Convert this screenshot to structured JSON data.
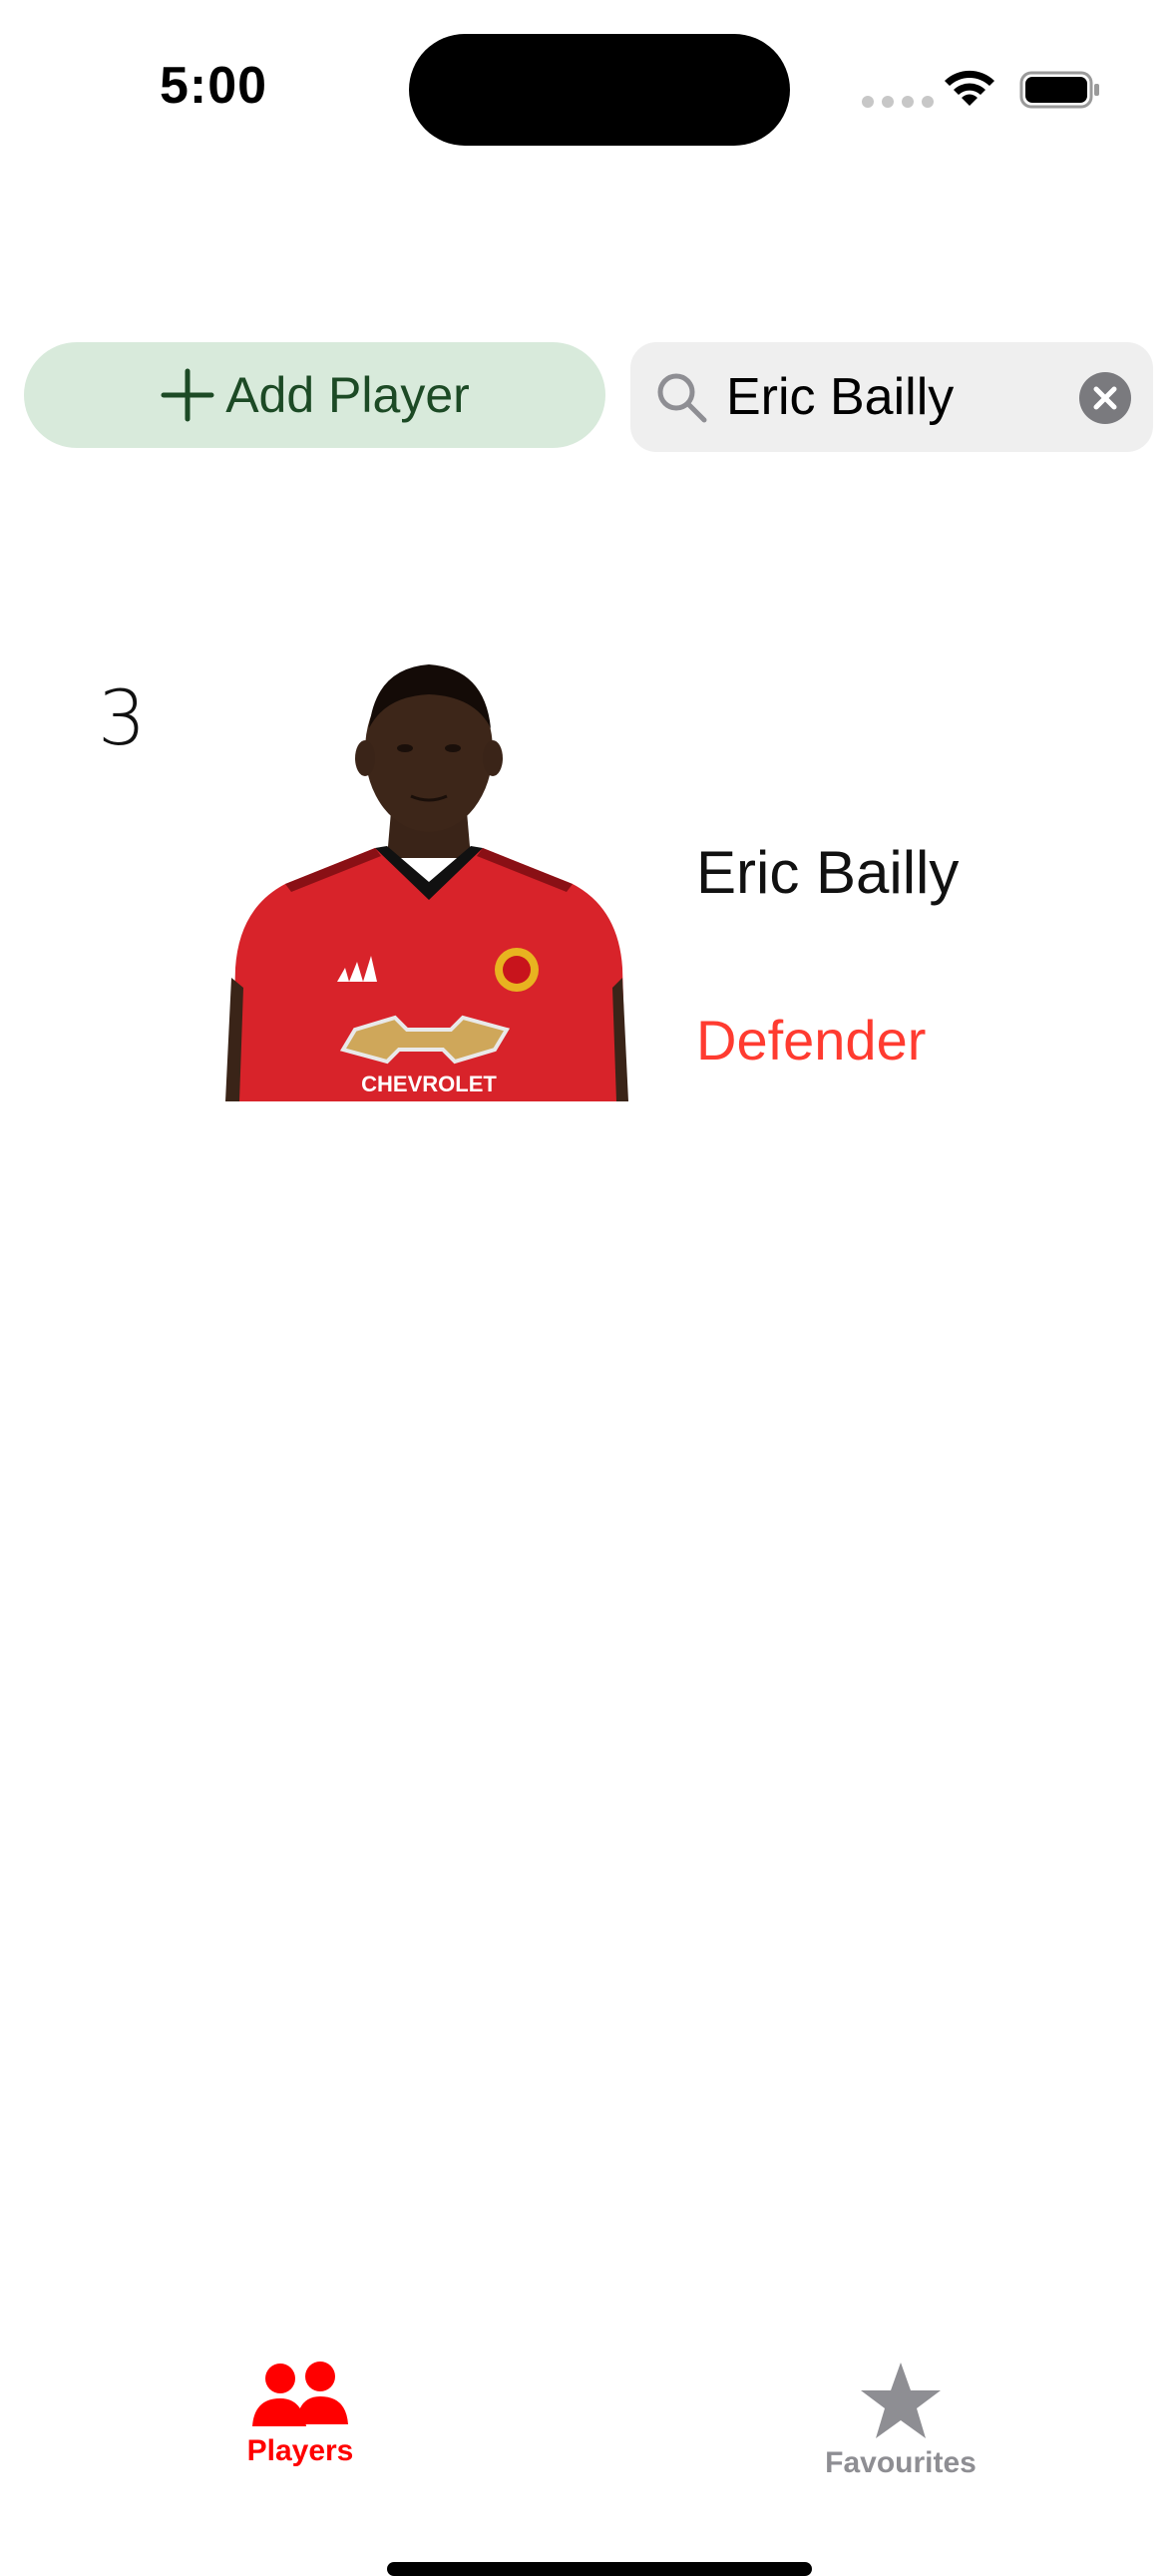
{
  "status_bar": {
    "time": "5:00"
  },
  "toolbar": {
    "add_player_label": "Add Player",
    "add_icon": "plus-icon"
  },
  "search": {
    "value": "Eric Bailly",
    "search_icon": "magnifying-glass-icon",
    "clear_icon": "xmark-circle-icon"
  },
  "players": [
    {
      "number": "3",
      "name": "Eric Bailly",
      "position": "Defender",
      "photo_icon": "player-photo",
      "shirt_sponsor": "CHEVROLET"
    }
  ],
  "tabs": [
    {
      "label": "Players",
      "icon": "person-2-fill-icon",
      "selected": true
    },
    {
      "label": "Favourites",
      "icon": "star-fill-icon",
      "selected": false
    }
  ],
  "colors": {
    "accent": "#ff0000",
    "defender_text": "#ff3b30",
    "add_button_bg": "#d8eadb",
    "add_button_text": "#1c4a25",
    "search_bg": "#efefef",
    "tab_inactive": "#8e8e93"
  }
}
